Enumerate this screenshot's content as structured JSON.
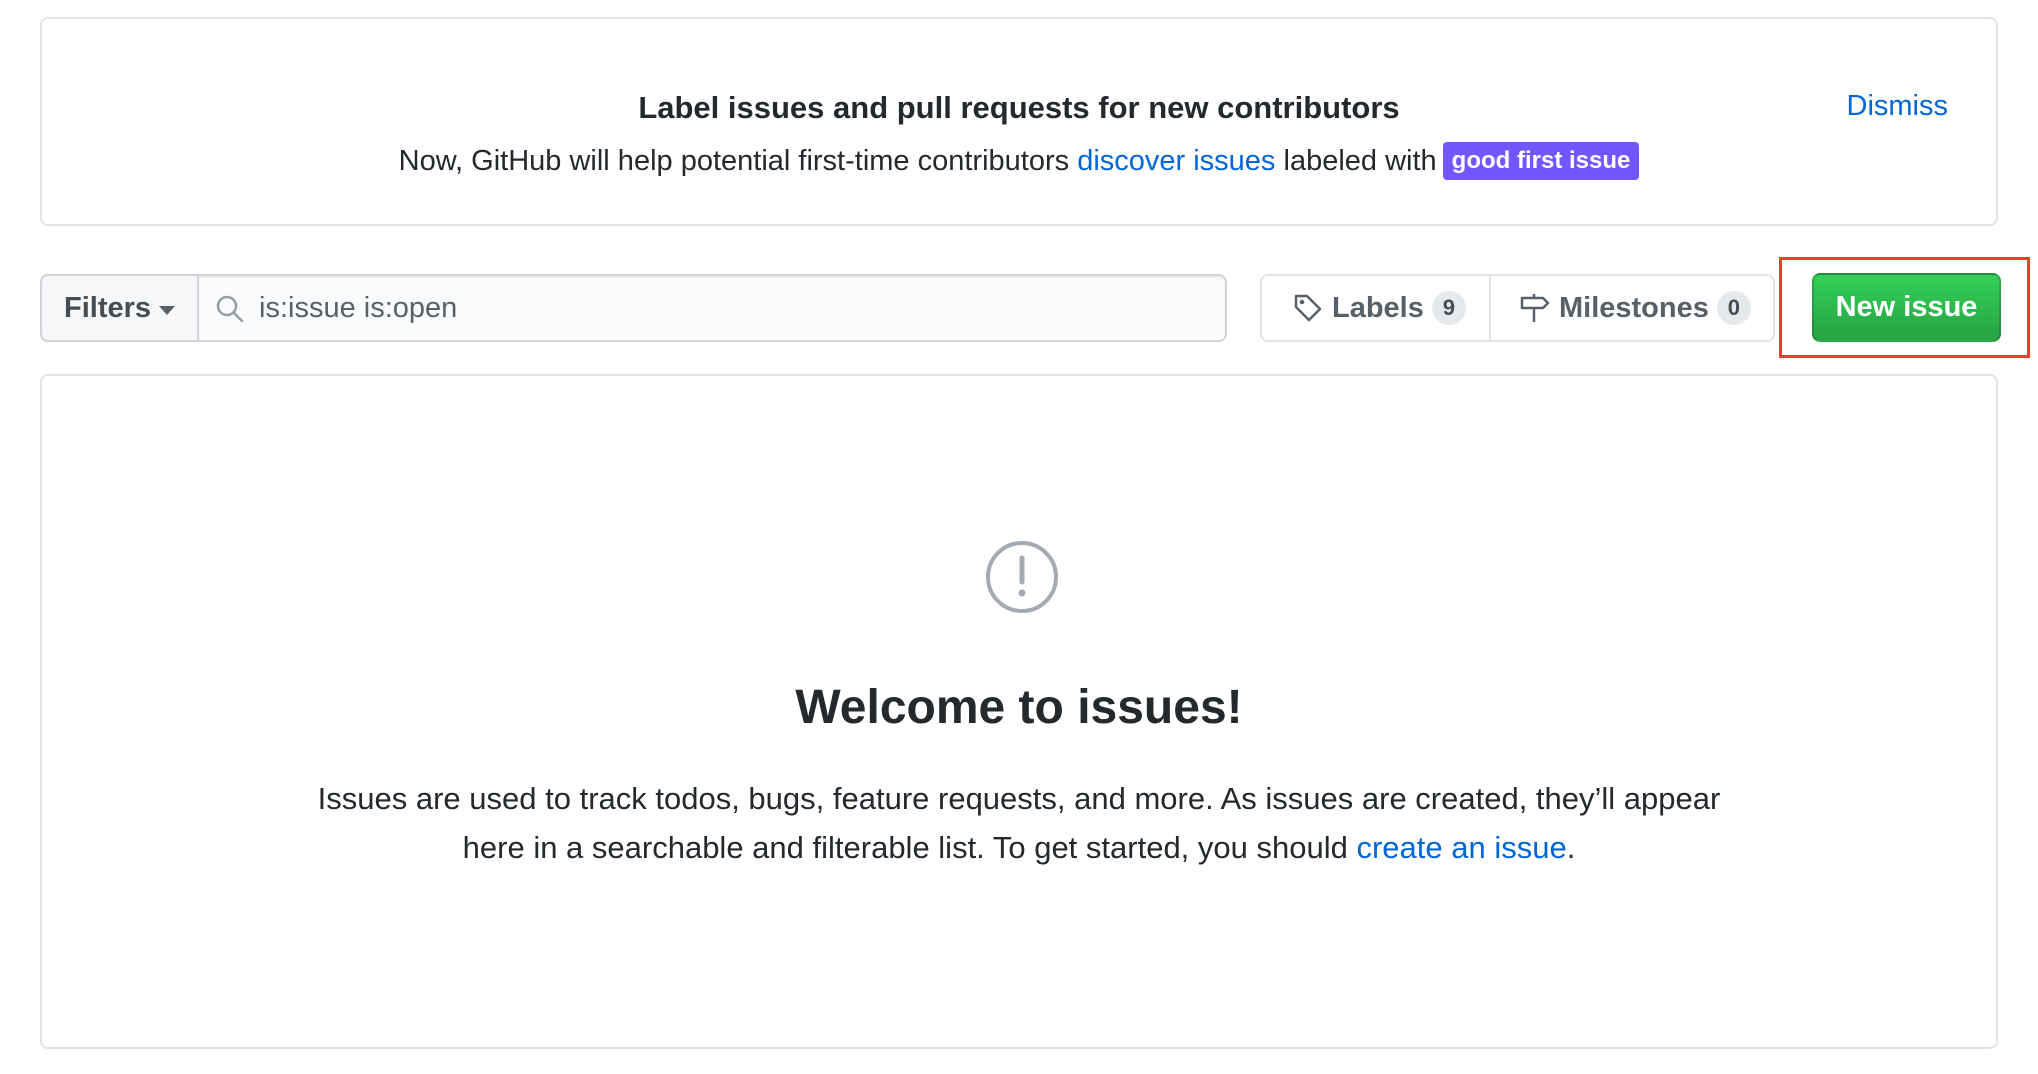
{
  "banner": {
    "title": "Label issues and pull requests for new contributors",
    "text_before": "Now, GitHub will help potential first-time contributors ",
    "link_text": "discover issues",
    "text_after": " labeled with",
    "badge_label": "good first issue",
    "badge_color": "#7057ff",
    "dismiss_label": "Dismiss"
  },
  "toolbar": {
    "filters_label": "Filters",
    "search_value": "is:issue is:open",
    "search_icon": "search-icon",
    "labels_label": "Labels",
    "labels_count": "9",
    "milestones_label": "Milestones",
    "milestones_count": "0",
    "new_issue_label": "New issue",
    "new_issue_color": "#28a745"
  },
  "blankslate": {
    "icon": "issue-opened-icon",
    "title": "Welcome to issues!",
    "text_line1": "Issues are used to track todos, bugs, feature requests, and more. As issues are created, they’ll appear",
    "text_line2_before": "here in a searchable and filterable list. To get started, you should ",
    "link_text": "create an issue",
    "text_line2_after": "."
  },
  "colors": {
    "link": "#0366d6",
    "highlight_border": "#e8402f"
  }
}
